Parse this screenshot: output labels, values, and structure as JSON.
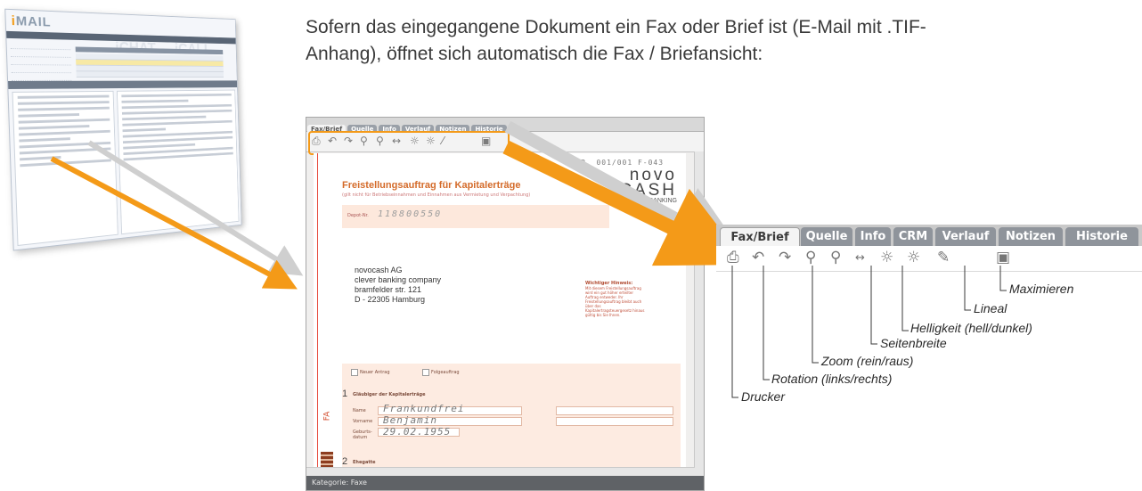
{
  "intro": {
    "line1": "Sofern das eingegangene Dokument ein Fax oder Brief ist (E-Mail mit .TIF-",
    "line2": "Anhang), öffnet sich automatisch die Fax / Briefansicht:"
  },
  "mini_app": {
    "logo_prefix": "i",
    "logo_main": "MAIL",
    "ghost1": "iCHAT",
    "ghost2": "iCALL"
  },
  "doc": {
    "tabs": [
      "Fax/Brief",
      "Quelle",
      "Info",
      "Verlauf",
      "Notizen",
      "Historie"
    ],
    "page_header": "P. 001/001   F-043",
    "brand_line1": "novo",
    "brand_line2": "CASH",
    "brand_line3": "CLEVER BANKING",
    "title": "Freistellungsauftrag für Kapitalerträge",
    "subtitle": "(gilt nicht für Betriebseinnahmen und Einnahmen aus Vermietung und Verpachtung)",
    "depot_label": "Depot-Nr.",
    "depot_value": "118800550",
    "address": [
      "novocash AG",
      "clever banking company",
      "bramfelder str. 121",
      "D - 22305 Hamburg"
    ],
    "notice_title": "Wichtiger Hinweis:",
    "notice_text": "Mit diesem Freistellungsauftrag wird ein gut höher erteilter Auftrag entweder. Ihr Freistellungsauftrag bleibt auch über das Kapitalertragsteuergesetz hinaus gültig bis Sie Ihnen.",
    "form_new": "Neuer Antrag",
    "form_follow": "Folgeauftrag",
    "section1_num": "1",
    "section1_title": "Gläubiger der Kapitalerträge",
    "label_name": "Name",
    "label_vorname": "Vorname",
    "label_geburt": "Geburts-datum",
    "value_name": "Frankundfrei",
    "value_vorname": "Benjamin",
    "value_geburt": "29.02.1955",
    "section2_num": "2",
    "section2_title": "Ehegatte",
    "side_label": "FA",
    "status": "Kategorie: Faxe"
  },
  "zoom_toolbar": {
    "tabs": [
      "Fax/Brief",
      "Quelle",
      "Info",
      "CRM",
      "Verlauf",
      "Notizen",
      "Historie"
    ],
    "icons": [
      "printer-icon",
      "rotate-left-icon",
      "rotate-right-icon",
      "zoom-in-icon",
      "zoom-out-icon",
      "page-width-icon",
      "brightness-up-icon",
      "brightness-down-icon",
      "ruler-icon",
      "maximize-icon"
    ]
  },
  "callouts": {
    "maximieren": "Maximieren",
    "lineal": "Lineal",
    "helligkeit": "Helligkeit (hell/dunkel)",
    "seitenbreite": "Seitenbreite",
    "zoom": "Zoom (rein/raus)",
    "rotation": "Rotation (links/rechts)",
    "drucker": "Drucker"
  },
  "colors": {
    "accent_orange": "#f49a18",
    "arrow_gray": "#c9c9c9",
    "tab_gray": "#8f949b"
  }
}
